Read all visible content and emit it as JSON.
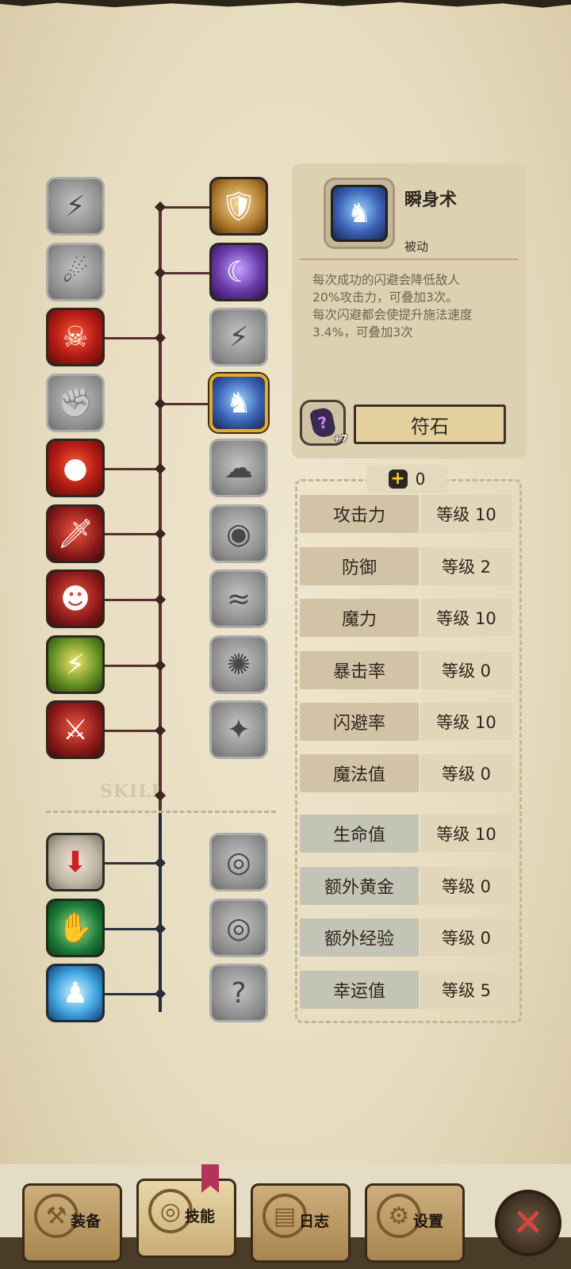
{
  "skill_detail": {
    "name": "瞬身术",
    "type": "被动",
    "description": "每次成功的闪避会降低敌人\n20%攻击力，可叠加3次。\n每次闪避都会使提升施法速度\n3.4%，可叠加3次",
    "rune_level": "+7",
    "rune_button": "符石"
  },
  "tree_watermark": "SKILL",
  "skill_points": "0",
  "stats": [
    {
      "name": "攻击力",
      "level": "等级 10"
    },
    {
      "name": "防御",
      "level": "等级 2"
    },
    {
      "name": "魔力",
      "level": "等级 10"
    },
    {
      "name": "暴击率",
      "level": "等级 0"
    },
    {
      "name": "闪避率",
      "level": "等级 10"
    },
    {
      "name": "魔法值",
      "level": "等级 0"
    },
    {
      "name": "生命值",
      "level": "等级 10"
    },
    {
      "name": "额外黄金",
      "level": "等级 0"
    },
    {
      "name": "额外经验",
      "level": "等级 0"
    },
    {
      "name": "幸运值",
      "level": "等级 5"
    }
  ],
  "nav": {
    "equipment": "装备",
    "skills": "技能",
    "log": "日志",
    "settings": "设置"
  },
  "colors": {
    "parchment": "#ede3cc",
    "selected_border": "#e6a92a",
    "tree_line": "#5a2f2f",
    "close_x": "#e0413b"
  }
}
